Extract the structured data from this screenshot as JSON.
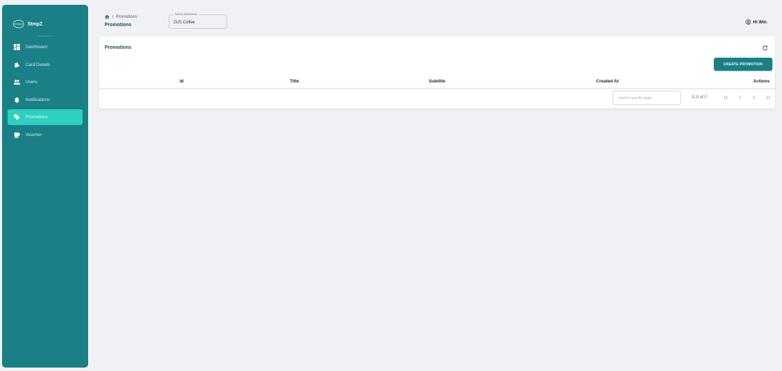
{
  "brand": {
    "logo_text": "STAMPZ",
    "name": "StmpZ"
  },
  "sidebar": {
    "items": [
      {
        "label": "Dashboard",
        "icon": "dashboard-icon"
      },
      {
        "label": "Card Details",
        "icon": "card-icon"
      },
      {
        "label": "Users",
        "icon": "users-icon"
      },
      {
        "label": "Notifications",
        "icon": "bell-icon"
      },
      {
        "label": "Promotions",
        "icon": "tag-icon",
        "active": true
      },
      {
        "label": "Voucher",
        "icon": "voucher-icon"
      }
    ]
  },
  "header": {
    "breadcrumb": "Promotions",
    "title": "Promotions",
    "business_select": {
      "legend": "Select Business",
      "value": "ZUS Coffee"
    },
    "user_greeting": "Hi Win"
  },
  "card": {
    "title": "Promotions",
    "create_label": "CREATE PROMOTION",
    "columns": [
      "Id",
      "Title",
      "Subtitle",
      "Created At",
      "Actions"
    ],
    "rows": [],
    "pagination": {
      "search_placeholder": "search specify page",
      "range": "0–0 of 0"
    }
  },
  "colors": {
    "sidebar": "#1a7f86",
    "active": "#2ecfbe",
    "button": "#1a7f86",
    "background": "#eff1f5"
  }
}
